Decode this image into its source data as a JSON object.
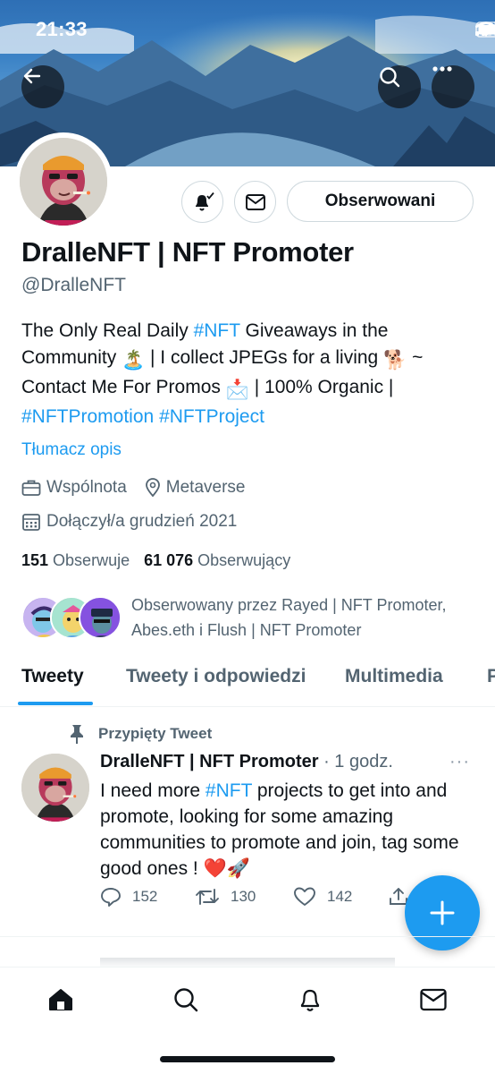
{
  "status_bar": {
    "time": "21:33"
  },
  "profile": {
    "name": "DralleNFT | NFT Promoter",
    "handle": "@DralleNFT",
    "follow_button_label": "Obserwowani",
    "bio": {
      "part1": "The Only Real Daily ",
      "tag1": "#NFT",
      "part2": " Giveaways in the Community ",
      "emoji1": "🏝️",
      "part3": " | I collect JPEGs for a living ",
      "emoji2": "🐕",
      "part4": " ~ Contact Me For Promos ",
      "emoji3": "📩",
      "part5": " | 100% Organic | ",
      "tag2": "#NFTPromotion",
      "tag3": "#NFTProject"
    },
    "translate_label": "Tłumacz opis",
    "category": "Wspólnota",
    "location": "Metaverse",
    "joined": "Dołączył/a grudzień 2021",
    "following_count": "151",
    "following_label": "Obserwuje",
    "followers_count": "61 076",
    "followers_label": "Obserwujący",
    "followed_by": "Obserwowany przez Rayed | NFT Promoter, Abes.eth i Flush | NFT Promoter"
  },
  "tabs": [
    {
      "label": "Tweety"
    },
    {
      "label": "Tweety i odpowiedzi"
    },
    {
      "label": "Multimedia"
    },
    {
      "label": "P"
    }
  ],
  "pinned_tweet": {
    "pinned_label": "Przypięty Tweet",
    "author": "DralleNFT | NFT Promoter",
    "time": " · 1 godz.",
    "text_part1": "I need more ",
    "tag": "#NFT",
    "text_part2": " projects to get into and promote, looking for some amazing communities to promote and join, tag some good ones ! ",
    "emoji": "❤️🚀",
    "replies": "152",
    "retweets": "130",
    "likes": "142"
  },
  "colors": {
    "accent": "#1d9bf0",
    "text": "#0f1419",
    "secondary": "#536471"
  },
  "icons": [
    "back-arrow-icon",
    "search-icon",
    "more-icon",
    "bell-icon",
    "mail-icon",
    "briefcase-icon",
    "location-icon",
    "calendar-icon",
    "pin-icon",
    "reply-icon",
    "retweet-icon",
    "like-icon",
    "share-icon",
    "compose-icon",
    "home-icon",
    "notifications-icon",
    "messages-icon"
  ]
}
